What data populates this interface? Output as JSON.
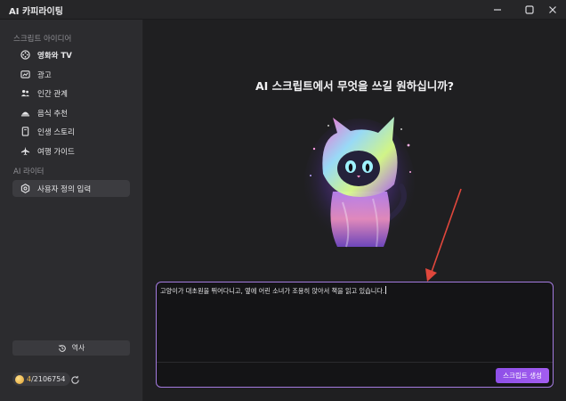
{
  "app": {
    "title": "AI 카피라이팅"
  },
  "window_controls": [
    {
      "name": "minimize-icon"
    },
    {
      "name": "maximize-icon"
    },
    {
      "name": "close-icon"
    }
  ],
  "sidebar": {
    "section_script_ideas": "스크립트 아이디어",
    "items": [
      {
        "label": "영화와 TV",
        "icon": "film-icon"
      },
      {
        "label": "광고",
        "icon": "ad-icon"
      },
      {
        "label": "인간 관계",
        "icon": "people-icon"
      },
      {
        "label": "음식 추천",
        "icon": "food-icon"
      },
      {
        "label": "인생 스토리",
        "icon": "book-icon"
      },
      {
        "label": "여행 가이드",
        "icon": "airplane-icon"
      }
    ],
    "section_ai_writer": "AI 라이터",
    "custom_input": {
      "label": "사용자 정의 입력",
      "icon": "gear-icon"
    },
    "history_label": "역사",
    "credits": {
      "used": "4",
      "total": "/2106754"
    }
  },
  "main": {
    "headline": "AI 스크립트에서 무엇을 쓰길 원하십니까?",
    "prompt_text": "고양이가 대초원을 뛰어다니고, 옆에 어린 소녀가 조용히 앉아서 책을 읽고 있습니다.",
    "generate_label": "스크립트 생성"
  },
  "colors": {
    "accent": "#a35df0",
    "arrow": "#e0473c",
    "credit_highlight": "#f0b84a"
  }
}
